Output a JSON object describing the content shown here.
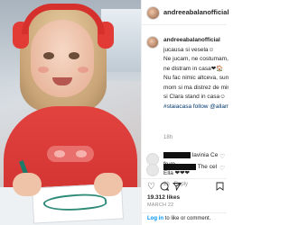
{
  "post": {
    "username": "andreeabalanofficial",
    "caption_lines": [
      "jucausa si vesela☺",
      "Ne jucam, ne costumam,",
      "ne distram in casa❤🏠",
      "Nu fac nimic altceva, sunt",
      "mom si ma distrez de mine",
      "si Clara stand in casa☺",
      "#staiacasa follow @allam"
    ],
    "time_ago": "18h",
    "likes": "19.312 likes",
    "date": "MARCH 22",
    "icons": [
      "like-icon",
      "comment-icon",
      "share-icon",
      "save-icon",
      "heart-icon"
    ]
  },
  "comments": [
    {
      "text": "lavinia Ce frum",
      "text2": "Ella ❤❤❤",
      "time": "2h",
      "reply": "Reply"
    },
    {
      "text": "The cel"
    }
  ],
  "footer": {
    "login_link": "Log in",
    "login_text": "to like or comment."
  }
}
